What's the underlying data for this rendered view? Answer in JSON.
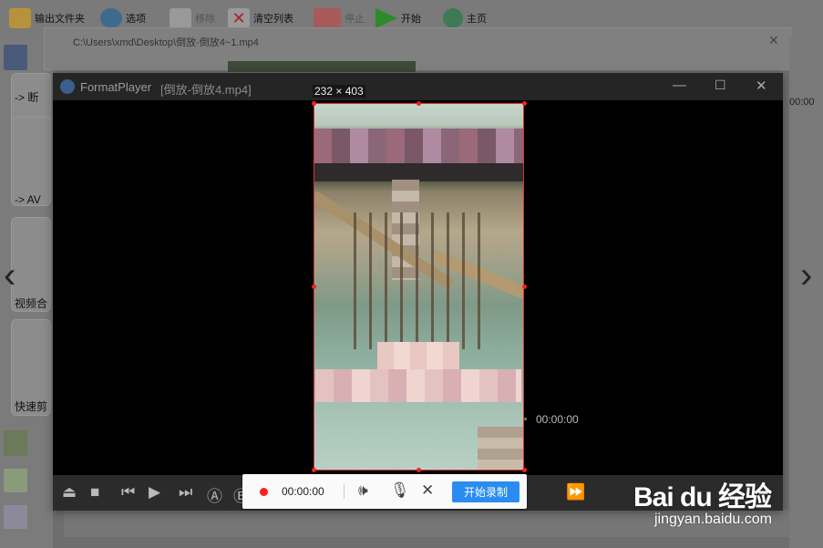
{
  "toolbar": {
    "output_folder": "输出文件夹",
    "options": "选项",
    "remove": "移除",
    "clear_list": "清空列表",
    "stop": "停止",
    "start": "开始",
    "home": "主页"
  },
  "sidebar": {
    "labels": [
      "-> 断",
      "-> AV",
      "视频合",
      "快速剪"
    ]
  },
  "background_window": {
    "path": "C:\\Users\\xmd\\Desktop\\倒放-倒放4~1.mp4",
    "right_time": "00:00"
  },
  "player": {
    "app_name": "FormatPlayer",
    "file_name": "[倒放-倒放4.mp4]",
    "selection_size": "232 × 403",
    "time": "00:00:00"
  },
  "recorder": {
    "time": "00:00:00",
    "start_label": "开始录制"
  },
  "watermark": {
    "logo": "Bai du 经验",
    "url": "jingyan.baidu.com"
  },
  "colors": {
    "record_red": "#ff1e1e",
    "start_blue": "#2a8cf0",
    "selection_red": "#e23232"
  }
}
